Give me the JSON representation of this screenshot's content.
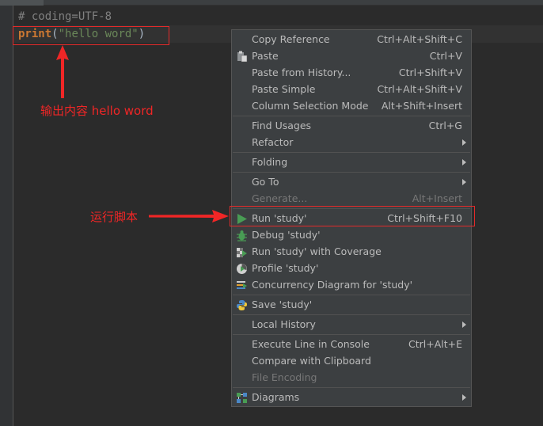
{
  "editor": {
    "line1": "# coding=UTF-8",
    "line2_keyword": "print",
    "line2_open": "(",
    "line2_string": "\"hello word\"",
    "line2_close": ")"
  },
  "annotations": {
    "output_label": "输出内容 hello word",
    "run_label": "运行脚本"
  },
  "menu": {
    "items": [
      {
        "label": "Copy Reference",
        "shortcut": "Ctrl+Alt+Shift+C"
      },
      {
        "label": "Paste",
        "shortcut": "Ctrl+V",
        "icon": "paste-icon"
      },
      {
        "label": "Paste from History...",
        "shortcut": "Ctrl+Shift+V"
      },
      {
        "label": "Paste Simple",
        "shortcut": "Ctrl+Alt+Shift+V"
      },
      {
        "label": "Column Selection Mode",
        "shortcut": "Alt+Shift+Insert"
      },
      {
        "label": "Find Usages",
        "shortcut": "Ctrl+G"
      },
      {
        "label": "Refactor",
        "submenu": true
      },
      {
        "label": "Folding",
        "submenu": true
      },
      {
        "label": "Go To",
        "submenu": true
      },
      {
        "label": "Generate...",
        "shortcut": "Alt+Insert",
        "disabled": true
      },
      {
        "label": "Run 'study'",
        "shortcut": "Ctrl+Shift+F10",
        "icon": "run-icon"
      },
      {
        "label": "Debug 'study'",
        "icon": "debug-icon"
      },
      {
        "label": "Run 'study' with Coverage",
        "icon": "coverage-icon"
      },
      {
        "label": "Profile 'study'",
        "icon": "profile-icon"
      },
      {
        "label": "Concurrency Diagram for  'study'",
        "icon": "concurrency-icon"
      },
      {
        "label": "Save 'study'",
        "icon": "python-icon"
      },
      {
        "label": "Local History",
        "submenu": true
      },
      {
        "label": "Execute Line in Console",
        "shortcut": "Ctrl+Alt+E"
      },
      {
        "label": "Compare with Clipboard"
      },
      {
        "label": "File Encoding",
        "disabled": true
      },
      {
        "label": "Diagrams",
        "submenu": true,
        "icon": "diagrams-icon"
      }
    ]
  },
  "colors": {
    "annotation_red": "#f02626",
    "run_green": "#499c54"
  }
}
